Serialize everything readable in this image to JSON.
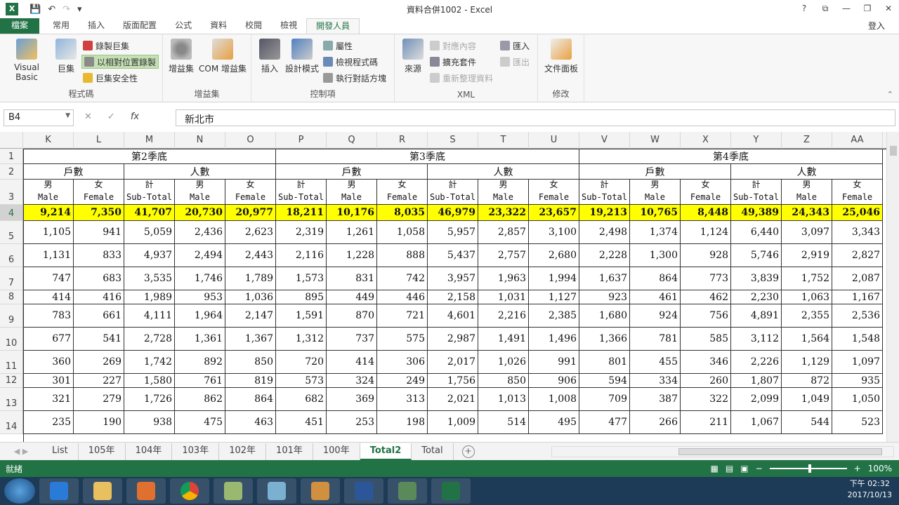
{
  "window": {
    "title": "資料合併1002 - Excel",
    "app_logo": "X",
    "controls": [
      "?",
      "⧉",
      "—",
      "❐",
      "✕"
    ]
  },
  "tabs": [
    "檔案",
    "常用",
    "插入",
    "版面配置",
    "公式",
    "資料",
    "校閱",
    "檢視",
    "開發人員"
  ],
  "login": "登入",
  "ribbon": {
    "groups": [
      "程式碼",
      "增益集",
      "控制項",
      "XML",
      "修改"
    ],
    "code": {
      "vb": "Visual Basic",
      "macro": "巨集",
      "record": "錄製巨集",
      "relative": "以相對位置錄製",
      "security": "巨集安全性"
    },
    "addins": {
      "addin": "增益集",
      "com": "COM 增益集"
    },
    "controls": {
      "insert": "插入",
      "design": "設計模式",
      "props": "屬性",
      "view_code": "檢視程式碼",
      "run_dialog": "執行對話方塊"
    },
    "xml": {
      "source": "來源",
      "map": "對應內容",
      "expand": "擴充套件",
      "refresh": "重新整理資料",
      "import": "匯入",
      "export": "匯出"
    },
    "modify": {
      "doc_panel": "文件面板"
    }
  },
  "formula_bar": {
    "name_box": "B4",
    "fx": "fx",
    "value": "新北市"
  },
  "columns": [
    "K",
    "L",
    "M",
    "N",
    "O",
    "P",
    "Q",
    "R",
    "S",
    "T",
    "U",
    "V",
    "W",
    "X",
    "Y",
    "Z",
    "AA"
  ],
  "row_numbers": [
    "1",
    "2",
    "3",
    "4",
    "5",
    "6",
    "7",
    "8",
    "9",
    "10",
    "11",
    "12",
    "13",
    "14"
  ],
  "quarters": [
    "第2季底",
    "第3季底",
    "第4季底"
  ],
  "group_labels": [
    "戶數",
    "人數"
  ],
  "subheaders": [
    [
      "男",
      "Male"
    ],
    [
      "女",
      "Female"
    ],
    [
      "計",
      "Sub-Total"
    ],
    [
      "男",
      "Male"
    ],
    [
      "女",
      "Female"
    ],
    [
      "計",
      "Sub-Total"
    ],
    [
      "男",
      "Male"
    ],
    [
      "女",
      "Female"
    ],
    [
      "計",
      "Sub-Total"
    ],
    [
      "男",
      "Male"
    ],
    [
      "女",
      "Female"
    ],
    [
      "計",
      "Sub-Total"
    ],
    [
      "男",
      "Male"
    ],
    [
      "女",
      "Female"
    ],
    [
      "計",
      "Sub-Total"
    ],
    [
      "男",
      "Male"
    ],
    [
      "女",
      "Female"
    ]
  ],
  "data_rows": [
    [
      "9,214",
      "7,350",
      "41,707",
      "20,730",
      "20,977",
      "18,211",
      "10,176",
      "8,035",
      "46,979",
      "23,322",
      "23,657",
      "19,213",
      "10,765",
      "8,448",
      "49,389",
      "24,343",
      "25,046"
    ],
    [
      "1,105",
      "941",
      "5,059",
      "2,436",
      "2,623",
      "2,319",
      "1,261",
      "1,058",
      "5,957",
      "2,857",
      "3,100",
      "2,498",
      "1,374",
      "1,124",
      "6,440",
      "3,097",
      "3,343"
    ],
    [
      "1,131",
      "833",
      "4,937",
      "2,494",
      "2,443",
      "2,116",
      "1,228",
      "888",
      "5,437",
      "2,757",
      "2,680",
      "2,228",
      "1,300",
      "928",
      "5,746",
      "2,919",
      "2,827"
    ],
    [
      "747",
      "683",
      "3,535",
      "1,746",
      "1,789",
      "1,573",
      "831",
      "742",
      "3,957",
      "1,963",
      "1,994",
      "1,637",
      "864",
      "773",
      "3,839",
      "1,752",
      "2,087"
    ],
    [
      "414",
      "416",
      "1,989",
      "953",
      "1,036",
      "895",
      "449",
      "446",
      "2,158",
      "1,031",
      "1,127",
      "923",
      "461",
      "462",
      "2,230",
      "1,063",
      "1,167"
    ],
    [
      "783",
      "661",
      "4,111",
      "1,964",
      "2,147",
      "1,591",
      "870",
      "721",
      "4,601",
      "2,216",
      "2,385",
      "1,680",
      "924",
      "756",
      "4,891",
      "2,355",
      "2,536"
    ],
    [
      "677",
      "541",
      "2,728",
      "1,361",
      "1,367",
      "1,312",
      "737",
      "575",
      "2,987",
      "1,491",
      "1,496",
      "1,366",
      "781",
      "585",
      "3,112",
      "1,564",
      "1,548"
    ],
    [
      "360",
      "269",
      "1,742",
      "892",
      "850",
      "720",
      "414",
      "306",
      "2,017",
      "1,026",
      "991",
      "801",
      "455",
      "346",
      "2,226",
      "1,129",
      "1,097"
    ],
    [
      "301",
      "227",
      "1,580",
      "761",
      "819",
      "573",
      "324",
      "249",
      "1,756",
      "850",
      "906",
      "594",
      "334",
      "260",
      "1,807",
      "872",
      "935"
    ],
    [
      "321",
      "279",
      "1,726",
      "862",
      "864",
      "682",
      "369",
      "313",
      "2,021",
      "1,013",
      "1,008",
      "709",
      "387",
      "322",
      "2,099",
      "1,049",
      "1,050"
    ],
    [
      "235",
      "190",
      "938",
      "475",
      "463",
      "451",
      "253",
      "198",
      "1,009",
      "514",
      "495",
      "477",
      "266",
      "211",
      "1,067",
      "544",
      "523"
    ]
  ],
  "sheet_tabs": [
    "List",
    "105年",
    "104年",
    "103年",
    "102年",
    "101年",
    "100年",
    "Total2",
    "Total"
  ],
  "active_sheet": "Total2",
  "status": {
    "ready": "就緒",
    "zoom": "100%"
  },
  "taskbar": {
    "time": "下午 02:32",
    "date": "2017/10/13"
  },
  "colors": {
    "excel_green": "#217346",
    "highlight": "#ffff00"
  }
}
